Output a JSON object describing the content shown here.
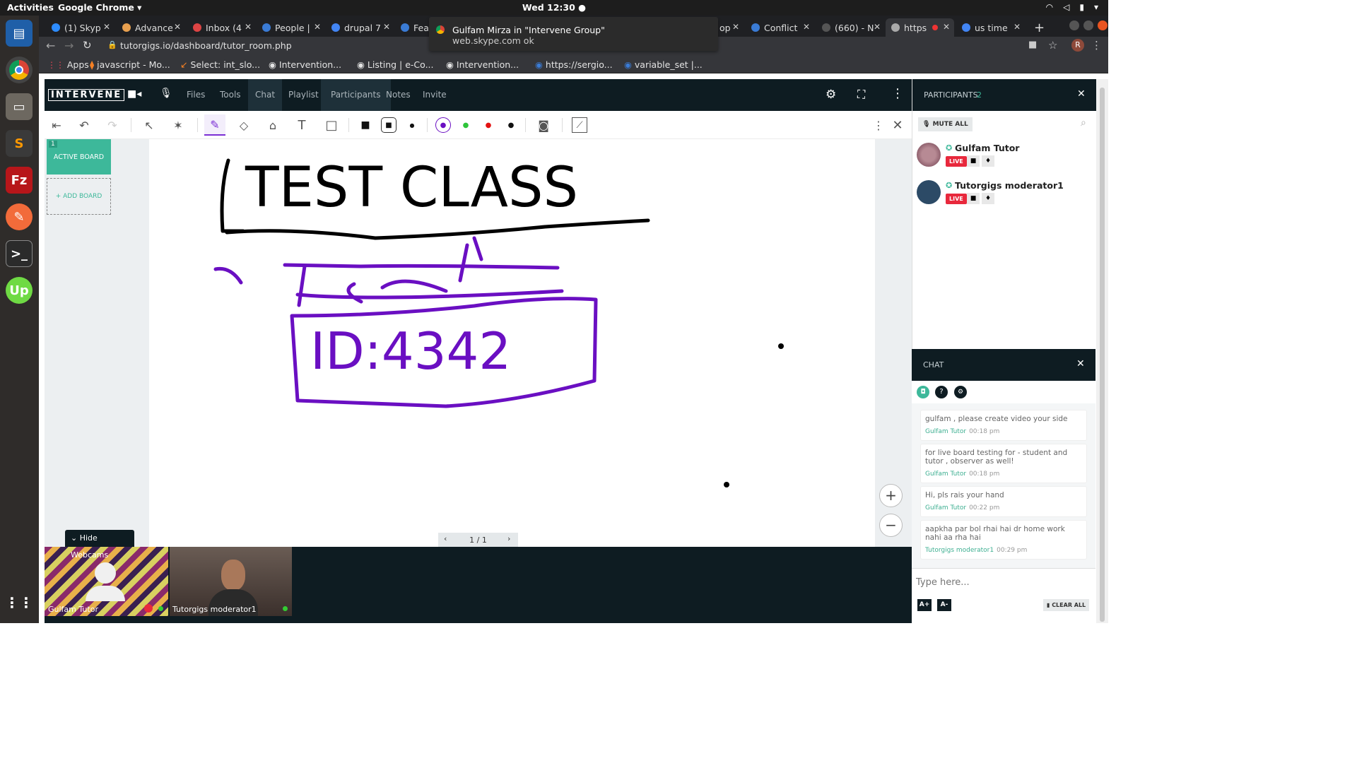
{
  "topbar": {
    "activities": "Activities",
    "app_name": "Google Chrome ▾",
    "clock": "Wed 12:30 ●"
  },
  "browser": {
    "tabs": [
      {
        "label": "(1) Skyp",
        "color": "#2d8cff"
      },
      {
        "label": "Advance",
        "color": "#e8a04f"
      },
      {
        "label": "Inbox (4",
        "color": "#d44"
      },
      {
        "label": "People |",
        "color": "#3a7bd5"
      },
      {
        "label": "drupal 7",
        "color": "#4285f4"
      },
      {
        "label": "Fea",
        "color": "#3a7bd5"
      },
      {
        "label": "op",
        "color": "#888"
      },
      {
        "label": "Conflict",
        "color": "#3a7bd5"
      },
      {
        "label": "(660) - N",
        "color": "#555"
      },
      {
        "label": "https",
        "color": "#aaa"
      },
      {
        "label": "us time",
        "color": "#4285f4"
      }
    ],
    "url": "tutorgigs.io/dashboard/tutor_room.php",
    "bookmarks": [
      "Apps",
      "javascript - Mo...",
      "Select: int_slo...",
      "Intervention...",
      "Listing | e-Co...",
      "Intervention...",
      "https://sergio...",
      "variable_set |..."
    ],
    "avatar_letter": "R"
  },
  "notification": {
    "title": "Gulfam Mirza in \"Intervene Group\"",
    "body": "web.skype.com  ok"
  },
  "app": {
    "logo": "INTERVENE",
    "nav": [
      "Files",
      "Tools",
      "Chat",
      "Playlist",
      "Participants",
      "Notes",
      "Invite"
    ]
  },
  "boards": {
    "active_number": "1",
    "active_label": "ACTIVE BOARD",
    "add_label": "+ ADD BOARD"
  },
  "whiteboard": {
    "text1": "TEST CLASS",
    "text2": "ID:4342",
    "page": "1 / 1",
    "ink_colors": [
      "#000000",
      "#6a0fc2"
    ]
  },
  "participants": {
    "title": "PARTICIPANTS",
    "count": "2",
    "mute_all": "MUTE ALL",
    "people": [
      {
        "name": "Gulfam Tutor",
        "badge": "LIVE"
      },
      {
        "name": "Tutorgigs moderator1",
        "badge": "LIVE"
      }
    ]
  },
  "chat": {
    "title": "CHAT",
    "messages": [
      {
        "text": "gulfam , please create video your side",
        "author": "Gulfam Tutor",
        "time": "00:18 pm"
      },
      {
        "text": "for live board testing for - student and tutor , observer as well!",
        "author": "Gulfam Tutor",
        "time": "00:18 pm"
      },
      {
        "text": "Hi, pls rais your hand",
        "author": "Gulfam Tutor",
        "time": "00:22 pm"
      },
      {
        "text": "aapkha par bol rhai hai dr home work nahi aa rha hai",
        "author": "Tutorgigs moderator1",
        "time": "00:29 pm"
      }
    ],
    "placeholder": "Type here...",
    "font_up": "A+",
    "font_down": "A-",
    "clear_all": "CLEAR ALL"
  },
  "webcams": {
    "hide_label": "Hide Webcams",
    "cams": [
      "Gulfam Tutor",
      "Tutorgigs moderator1"
    ]
  },
  "colors": {
    "accent": "#3db89a",
    "dark": "#0e1c22",
    "live": "#e8283c",
    "pen_purple": "#6a0fc2"
  }
}
